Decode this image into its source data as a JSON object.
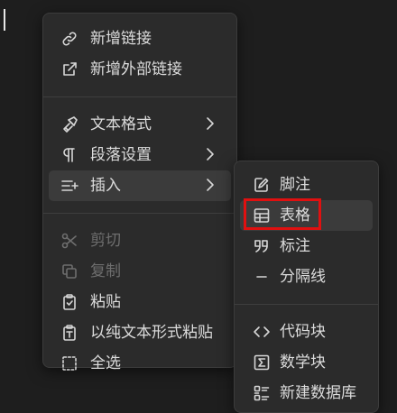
{
  "context_menu": {
    "items": [
      {
        "label": "新增链接",
        "icon": "link-icon"
      },
      {
        "label": "新增外部链接",
        "icon": "external-link-icon"
      },
      {
        "label": "文本格式",
        "icon": "brush-icon",
        "has_submenu": true
      },
      {
        "label": "段落设置",
        "icon": "pilcrow-icon",
        "has_submenu": true
      },
      {
        "label": "插入",
        "icon": "insert-icon",
        "has_submenu": true,
        "active": true
      },
      {
        "label": "剪切",
        "icon": "scissors-icon",
        "disabled": true
      },
      {
        "label": "复制",
        "icon": "copy-icon",
        "disabled": true
      },
      {
        "label": "粘贴",
        "icon": "clipboard-icon"
      },
      {
        "label": "以纯文本形式粘贴",
        "icon": "clipboard-text-icon"
      },
      {
        "label": "全选",
        "icon": "select-all-icon"
      }
    ]
  },
  "insert_submenu": {
    "items": [
      {
        "label": "脚注",
        "icon": "footnote-icon"
      },
      {
        "label": "表格",
        "icon": "table-icon",
        "active": true
      },
      {
        "label": "标注",
        "icon": "quote-icon"
      },
      {
        "label": "分隔线",
        "icon": "divider-icon"
      },
      {
        "label": "代码块",
        "icon": "code-icon"
      },
      {
        "label": "数学块",
        "icon": "sigma-icon"
      },
      {
        "label": "新建数据库",
        "icon": "database-icon"
      }
    ]
  },
  "colors": {
    "background": "#1e1e1e",
    "menu_bg": "#2b2b2b",
    "highlight_border": "#e01010"
  }
}
